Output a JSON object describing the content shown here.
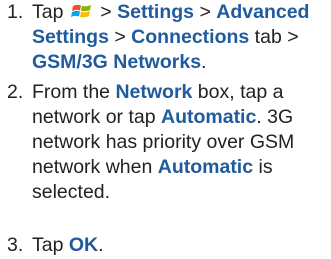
{
  "colors": {
    "text": "#222222",
    "link_blue": "#1f5b9e"
  },
  "steps": [
    {
      "num": "1.",
      "parts": [
        {
          "t": "Tap ",
          "b": false
        },
        {
          "icon": "windows-start-icon"
        },
        {
          "t": " > ",
          "b": false
        },
        {
          "t": "Settings",
          "b": true
        },
        {
          "t": " > ",
          "b": false
        },
        {
          "t": "Advanced Settings",
          "b": true
        },
        {
          "t": " > ",
          "b": false
        },
        {
          "t": "Connections",
          "b": true
        },
        {
          "t": " tab > ",
          "b": false
        },
        {
          "t": "GSM/3G Networks",
          "b": true
        },
        {
          "t": ".",
          "b": false
        }
      ]
    },
    {
      "num": "2.",
      "parts": [
        {
          "t": "From the ",
          "b": false
        },
        {
          "t": "Network",
          "b": true
        },
        {
          "t": " box, tap a network or tap ",
          "b": false
        },
        {
          "t": "Automatic",
          "b": true
        },
        {
          "t": ". 3G network has priority over GSM network when ",
          "b": false
        },
        {
          "t": "Automatic",
          "b": true
        },
        {
          "t": " is selected.",
          "b": false
        }
      ]
    },
    {
      "num": "3.",
      "parts": [
        {
          "t": "Tap ",
          "b": false
        },
        {
          "t": "OK",
          "b": true
        },
        {
          "t": ".",
          "b": false
        }
      ]
    }
  ]
}
